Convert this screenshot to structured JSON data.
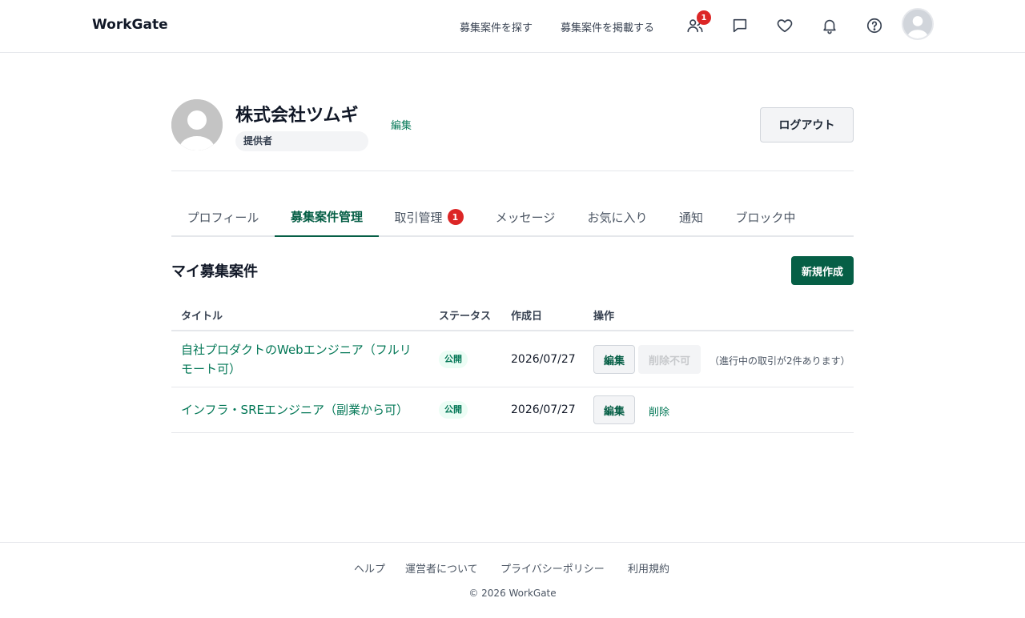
{
  "header": {
    "logo": "WorkGate",
    "nav": [
      "募集案件を探す",
      "募集案件を掲載する"
    ],
    "icons": [
      {
        "name": "users-icon",
        "badge": "1"
      },
      {
        "name": "message-icon"
      },
      {
        "name": "heart-icon"
      },
      {
        "name": "bell-icon"
      },
      {
        "name": "help-icon"
      }
    ]
  },
  "profile": {
    "company_name": "株式会社ツムギ",
    "role": "提供者",
    "edit_label": "編集",
    "logout_label": "ログアウト"
  },
  "tabs": [
    {
      "label": "プロフィール",
      "active": false
    },
    {
      "label": "募集案件管理",
      "active": true
    },
    {
      "label": "取引管理",
      "badge": "1",
      "active": false
    },
    {
      "label": "メッセージ",
      "active": false
    },
    {
      "label": "お気に入り",
      "active": false
    },
    {
      "label": "通知",
      "active": false
    },
    {
      "label": "ブロック中",
      "active": false
    }
  ],
  "section": {
    "title": "マイ募集案件",
    "new_button": "新規作成"
  },
  "table": {
    "headers": [
      "タイトル",
      "ステータス",
      "作成日",
      "操作"
    ],
    "rows": [
      {
        "title": "自社プロダクトのWebエンジニア（フルリモート可）",
        "status": "公開",
        "date": "2026/07/27",
        "edit": "編集",
        "delete_disabled": "削除不可",
        "note": "（進行中の取引が2件あります）"
      },
      {
        "title": "インフラ・SREエンジニア（副業から可）",
        "status": "公開",
        "date": "2026/07/27",
        "edit": "編集",
        "delete": "削除"
      }
    ]
  },
  "footer": {
    "links": [
      "ヘルプ",
      "運営者について",
      "プライバシーポリシー",
      "利用規約"
    ],
    "copyright": "© 2026 WorkGate"
  },
  "colors": {
    "accent": "#065f46",
    "link": "#047857",
    "badge": "#dc2626"
  }
}
